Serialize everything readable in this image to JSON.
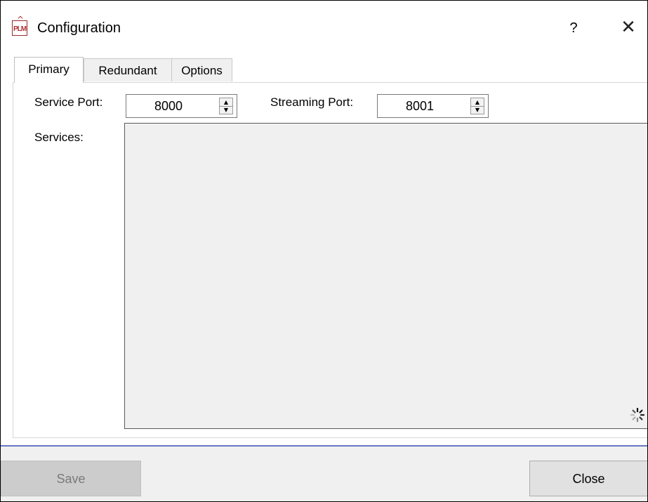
{
  "window": {
    "title": "Configuration",
    "app_icon_label": "PLM",
    "help_label": "?",
    "close_label": "✕"
  },
  "tabs": [
    {
      "label": "Primary",
      "active": true
    },
    {
      "label": "Redundant",
      "active": false
    },
    {
      "label": "Options",
      "active": false
    }
  ],
  "primary": {
    "service_port_label": "Service Port:",
    "service_port_value": "8000",
    "streaming_port_label": "Streaming Port:",
    "streaming_port_value": "8001",
    "services_label": "Services:",
    "services_loading_icon": "spinner-icon"
  },
  "footer": {
    "save_label": "Save",
    "close_label": "Close"
  },
  "colors": {
    "separator": "#6a76c4",
    "footer_bg": "#f0f0f0",
    "services_bg": "#f0f0f0",
    "app_icon_red": "#b03030"
  }
}
